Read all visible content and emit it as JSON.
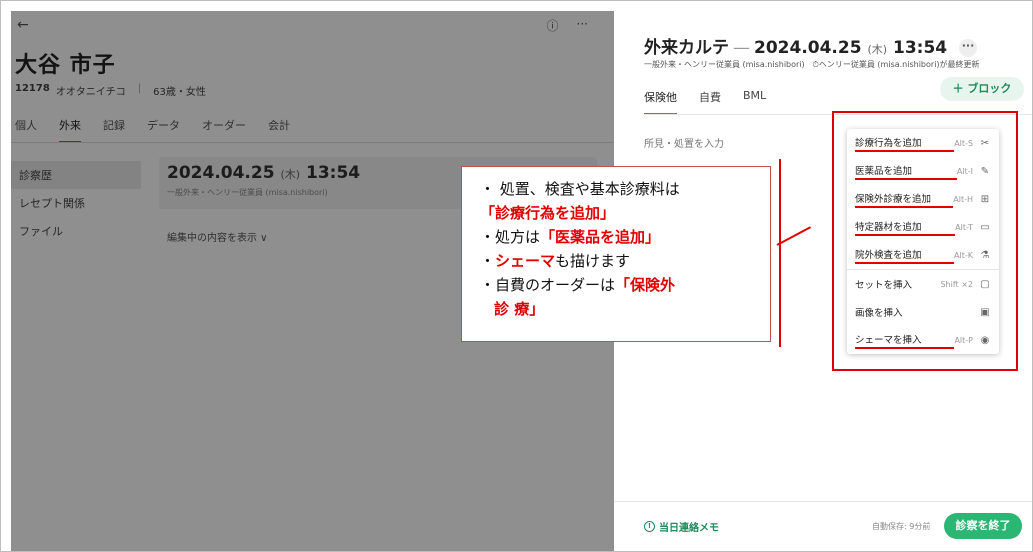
{
  "left": {
    "back_icon": "arrow-left-icon",
    "patient_name": "大谷 市子",
    "patient_id": "12178",
    "patient_kana": "オオタニイチコ",
    "patient_age_sex": "63歳・女性",
    "tabs": [
      "個人",
      "外来",
      "記録",
      "データ",
      "オーダー",
      "会計"
    ],
    "active_tab": "外来",
    "side_items": [
      "診察歴",
      "レセプト関係",
      "ファイル"
    ],
    "card": {
      "date": "2024.04.25",
      "dow": "(木)",
      "time": "13:54",
      "sub": "一般外来・ヘンリー従業員 (misa.nishibori)"
    },
    "editing_link": "編集中の内容を表示 ∨"
  },
  "right": {
    "title_main": "外来カルテ",
    "title_dash": "—",
    "title_date": "2024.04.25",
    "title_dow": "(木)",
    "title_time": "13:54",
    "title_more": "···",
    "subline": "一般外来・ヘンリー従業員 (misa.nishibori)　⏱ヘンリー従業員 (misa.nishibori)が最終更新",
    "tabs": [
      "保険他",
      "自費",
      "BML"
    ],
    "block_button": "＋ ブロック",
    "input_placeholder": "所見・処置を入力",
    "memo_label": "当日連絡メモ",
    "autosave": "自動保存: 9分前",
    "end_button": "診察を終了"
  },
  "menu": {
    "items": [
      {
        "label": "診療行為を追加",
        "shortcut": "Alt-S",
        "icon": "✂"
      },
      {
        "label": "医薬品を追加",
        "shortcut": "Alt-I",
        "icon": "✎"
      },
      {
        "label": "保険外診療を追加",
        "shortcut": "Alt-H",
        "icon": "⊞"
      },
      {
        "label": "特定器材を追加",
        "shortcut": "Alt-T",
        "icon": "▭"
      },
      {
        "label": "院外検査を追加",
        "shortcut": "Alt-K",
        "icon": "⚗"
      },
      {
        "label": "セットを挿入",
        "shortcut": "Shift ×2",
        "icon": "▢"
      },
      {
        "label": "画像を挿入",
        "shortcut": "",
        "icon": "▣"
      },
      {
        "label": "シェーマを挿入",
        "shortcut": "Alt-P",
        "icon": "◉"
      }
    ]
  },
  "callout": {
    "l1a": "・ 処置、検査や基本診療料は",
    "l1b": "「診療行為を追加」",
    "l2a": "・処方は",
    "l2b": "「医薬品を追加」",
    "l3a": "・",
    "l3b": "シェーマ",
    "l3c": "も描けます",
    "l4a": "・自費のオーダーは",
    "l4b": "「保険外",
    "l4c": "診 療」"
  },
  "colors": {
    "accent_green": "#2bb673",
    "annotation_red": "#e00000"
  }
}
